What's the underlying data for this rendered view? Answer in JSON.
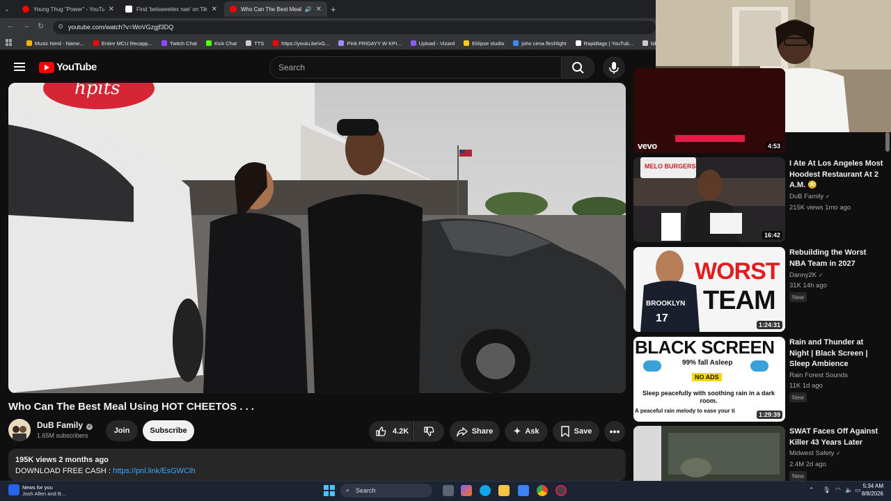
{
  "browser": {
    "tabs": [
      {
        "title": "Young Thug \"Power\" - YouTube",
        "favicon_color": "#ff0000"
      },
      {
        "title": "Find 'belsweetiex nae' on TikTok",
        "favicon_color": "#ffffff"
      },
      {
        "title": "Who Can The Best Meal Us",
        "favicon_color": "#ff0000"
      }
    ],
    "url": "youtube.com/watch?v=WoVGzgjf3DQ",
    "bookmarks": [
      {
        "label": "Music Nerd - Name...",
        "color": "#f4b400"
      },
      {
        "label": "Entire MCU Recapp...",
        "color": "#ff0000"
      },
      {
        "label": "Twitch Chat",
        "color": "#9146ff"
      },
      {
        "label": "Kick Chat",
        "color": "#53fc18"
      },
      {
        "label": "TTS",
        "color": "#cccccc"
      },
      {
        "label": "https://youtu.be/vG...",
        "color": "#ff0000"
      },
      {
        "label": "Pink FRIDAYY W KPI...",
        "color": "#a78bfa"
      },
      {
        "label": "Upload - Vizard",
        "color": "#8b5cf6"
      },
      {
        "label": "Eklipse studio",
        "color": "#facc15"
      },
      {
        "label": "john cena fleshlight",
        "color": "#4285f4"
      },
      {
        "label": "Rapidtags | YouTub...",
        "color": "#ffffff"
      },
      {
        "label": "bih link",
        "color": "#cccccc"
      }
    ]
  },
  "header": {
    "logo_text": "YouTube",
    "search_placeholder": "Search"
  },
  "video": {
    "title": "Who Can The Best Meal Using HOT CHEETOS . . .",
    "channel": "DuB Family",
    "subscribers": "1.65M subscribers",
    "join_label": "Join",
    "subscribe_label": "Subscribe",
    "likes": "4.2K",
    "share_label": "Share",
    "ask_label": "Ask",
    "save_label": "Save",
    "views_date": "195K views  2 months ago",
    "description_prefix": "DOWNLOAD FREE CASH : ",
    "description_link": "https://pnl.link/EsGWClh",
    "sign_text": "hpits"
  },
  "related": [
    {
      "title": "",
      "channel": "",
      "meta": "",
      "duration": "4:53",
      "badge": "vevo",
      "new": ""
    },
    {
      "title": "I Ate At Los Angeles Most Hoodest Restaurant At 2 A.M. 😳",
      "channel": "DuB Family",
      "meta": "215K views  1mo ago",
      "duration": "16:42",
      "thumb_text": "MELO BURGERS",
      "new": ""
    },
    {
      "title": "Rebuilding the Worst NBA Team in 2027",
      "channel": "Danny2K",
      "meta": "31K  14h ago",
      "duration": "1:24:31",
      "thumb_text_1": "WORST",
      "thumb_text_2": "TEAM",
      "jersey": "BROOKLYN",
      "jersey_num": "17",
      "new": "New"
    },
    {
      "title": "Rain and Thunder at Night | Black Screen | Sleep Ambience",
      "channel": "Rain Forest Sounds",
      "meta": "11K  1d ago",
      "duration": "1:29:39",
      "thumb_text_1": "BLACK SCREEN",
      "thumb_text_2": "99% fall Asleep",
      "thumb_badge": "NO ADS",
      "thumb_text_3": "Sleep peacefully with soothing rain in a dark room.",
      "thumb_text_4": "A peaceful rain melody to ease your ti",
      "new": "New"
    },
    {
      "title": "SWAT Faces Off Against Killer 43 Years Later",
      "channel": "Midwest Safety",
      "meta": "2.4M  2d ago",
      "duration": "",
      "new": "New"
    }
  ],
  "taskbar": {
    "news_title": "News for you",
    "news_sub": "Josh Allen and B...",
    "search_label": "Search",
    "time": "5:34 AM",
    "date": "8/8/2026"
  }
}
